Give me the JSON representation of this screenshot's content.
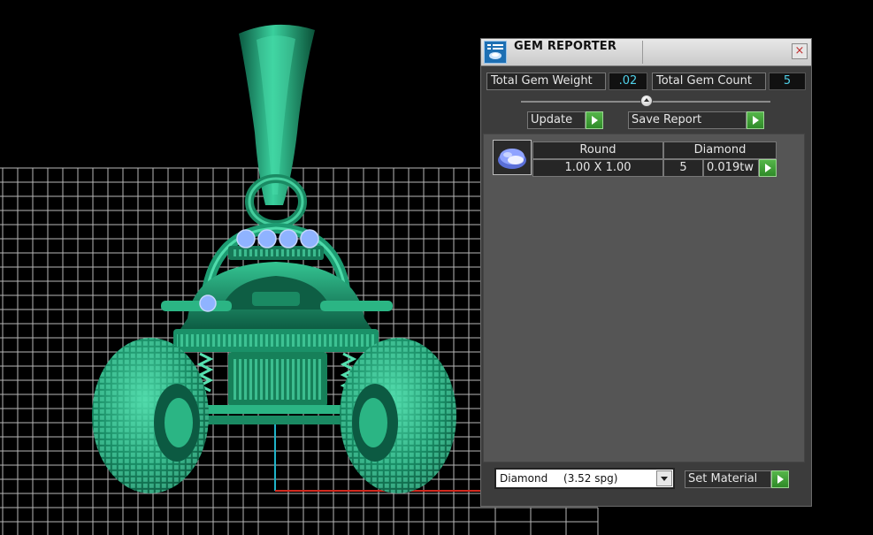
{
  "panel": {
    "title": "GEM REPORTER",
    "close_symbol": "×",
    "total_gem_weight_label": "Total Gem Weight",
    "total_gem_weight_value": ".02",
    "total_gem_count_label": "Total Gem Count",
    "total_gem_count_value": "5",
    "update_label": "Update",
    "save_report_label": "Save Report",
    "gems": [
      {
        "shape": "Round",
        "material": "Diamond",
        "size": "1.00 X 1.00",
        "count": "5",
        "weight": "0.019tw"
      }
    ],
    "material_select": {
      "name": "Diamond",
      "gravity": "(3.52 spg)"
    },
    "set_material_label": "Set Material"
  },
  "icons": {
    "app": "gem-reporter-app-icon",
    "gem": "round-diamond-gem-icon",
    "close": "close-icon",
    "play": "play-arrow-icon"
  },
  "colors": {
    "model": "#1f9a73",
    "grid": "#d8d8d8",
    "axis_x": "#d22a1f",
    "axis_y": "#1fb3c8",
    "value_text": "#4fd0e8",
    "gem_highlight": "#8fb3ff"
  }
}
